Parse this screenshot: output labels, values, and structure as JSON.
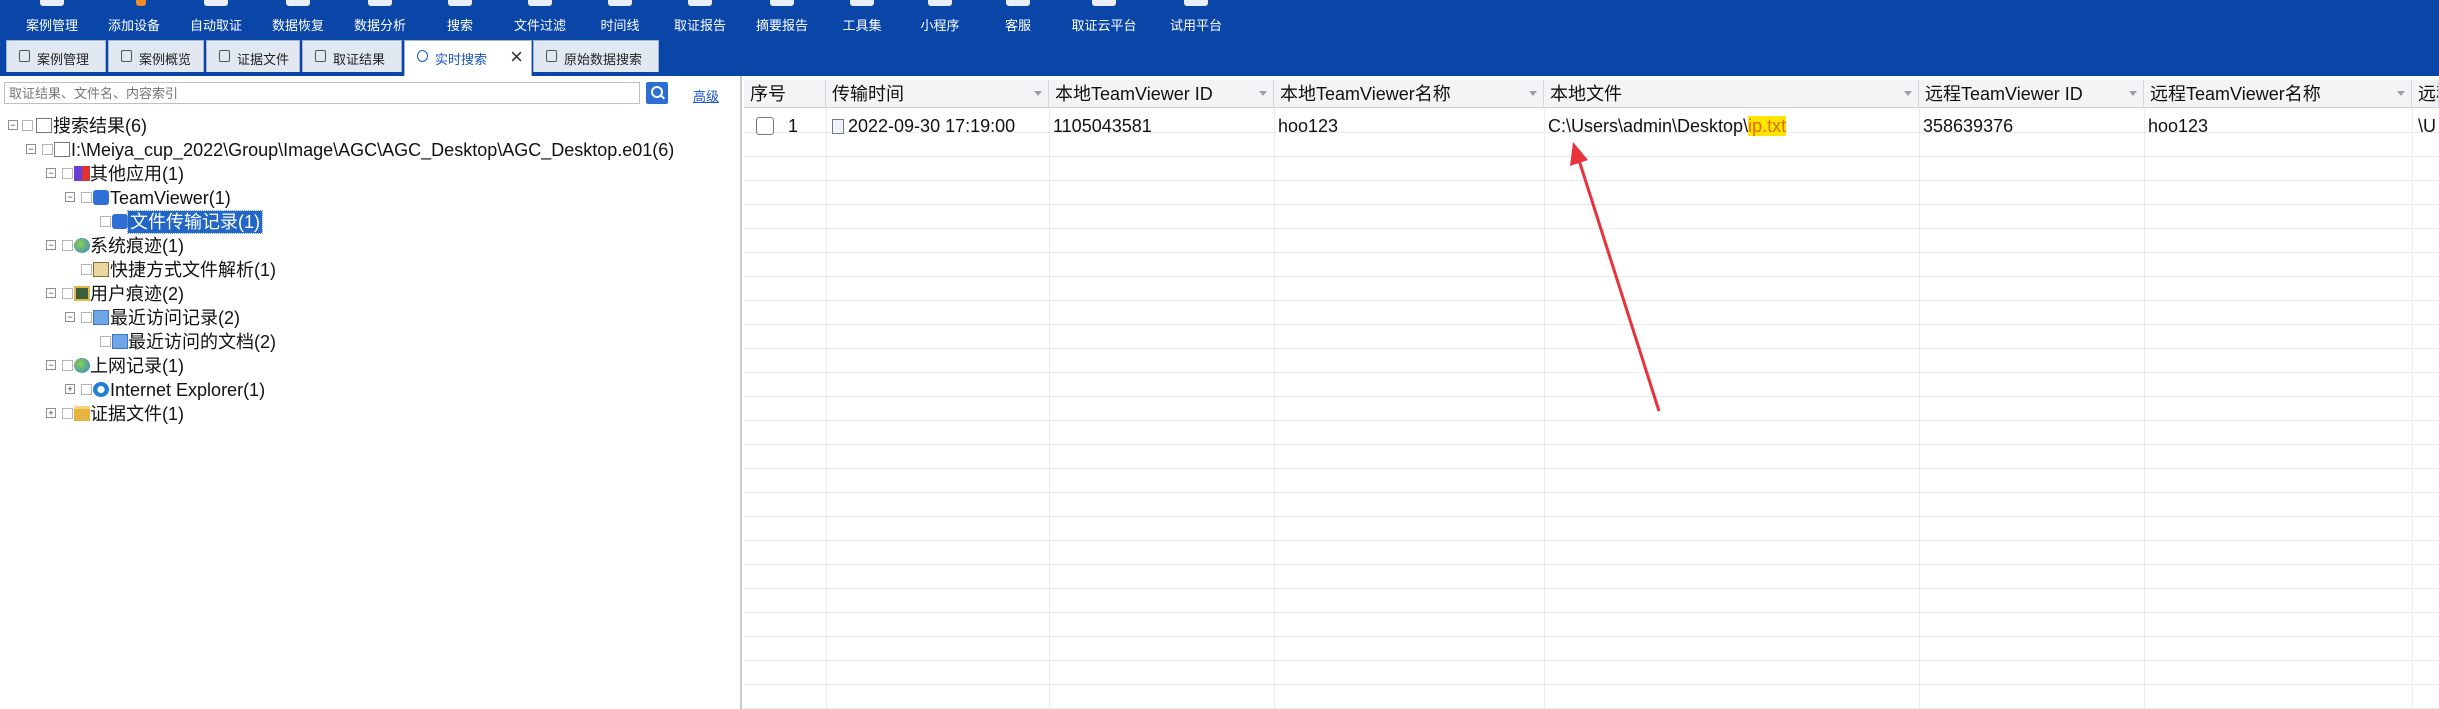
{
  "toolbar": {
    "items": [
      {
        "label": "案例管理",
        "icon": "case-icon"
      },
      {
        "label": "添加设备",
        "icon": "add-device-icon"
      },
      {
        "label": "自动取证",
        "icon": "auto-forensics-icon"
      },
      {
        "label": "数据恢复",
        "icon": "data-recovery-icon"
      },
      {
        "label": "数据分析",
        "icon": "data-analysis-icon"
      },
      {
        "label": "搜索",
        "icon": "search-icon"
      },
      {
        "label": "文件过滤",
        "icon": "file-filter-icon"
      },
      {
        "label": "时间线",
        "icon": "timeline-icon"
      },
      {
        "label": "取证报告",
        "icon": "report-icon"
      },
      {
        "label": "摘要报告",
        "icon": "summary-report-icon"
      },
      {
        "label": "工具集",
        "icon": "toolset-icon"
      },
      {
        "label": "小程序",
        "icon": "mini-program-icon"
      },
      {
        "label": "客服",
        "icon": "support-icon"
      },
      {
        "label": "取证云平台",
        "icon": "cloud-platform-icon"
      },
      {
        "label": "试用平台",
        "icon": "trial-platform-icon"
      }
    ],
    "bg_color": "#0a46a8"
  },
  "tabs": [
    {
      "label": "案例管理",
      "icon": "edit-icon"
    },
    {
      "label": "案例概览",
      "icon": "overview-icon"
    },
    {
      "label": "证据文件",
      "icon": "evidence-file-icon"
    },
    {
      "label": "取证结果",
      "icon": "result-icon"
    },
    {
      "label": "实时搜索",
      "icon": "search-icon",
      "active": true
    },
    {
      "label": "原始数据搜索",
      "icon": "raw-search-icon"
    }
  ],
  "left": {
    "search_placeholder": "取证结果、文件名、内容索引",
    "advanced_label": "高级"
  },
  "tree": [
    {
      "label": "搜索结果(6)",
      "icon": "doc"
    },
    {
      "label": "I:\\Meiya_cup_2022\\Group\\Image\\AGC\\AGC_Desktop\\AGC_Desktop.e01(6)",
      "icon": "doc"
    },
    {
      "label": "其他应用(1)",
      "icon": "apps"
    },
    {
      "label": "TeamViewer(1)",
      "icon": "tv"
    },
    {
      "label": "文件传输记录(1)",
      "icon": "tv",
      "selected": true
    },
    {
      "label": "系统痕迹(1)",
      "icon": "globe"
    },
    {
      "label": "快捷方式文件解析(1)",
      "icon": "lnk"
    },
    {
      "label": "用户痕迹(2)",
      "icon": "user"
    },
    {
      "label": "最近访问记录(2)",
      "icon": "recent"
    },
    {
      "label": "最近访问的文档(2)",
      "icon": "recent"
    },
    {
      "label": "上网记录(1)",
      "icon": "globe"
    },
    {
      "label": "Internet Explorer(1)",
      "icon": "ie"
    },
    {
      "label": "证据文件(1)",
      "icon": "folder"
    }
  ],
  "grid": {
    "columns": [
      "序号",
      "传输时间",
      "本地TeamViewer ID",
      "本地TeamViewer名称",
      "本地文件",
      "远程TeamViewer ID",
      "远程TeamViewer名称",
      "远程"
    ],
    "rows": [
      {
        "index": "1",
        "time": "2022-09-30 17:19:00",
        "local_id": "1105043581",
        "local_name": "hoo123",
        "local_file_prefix": "C:\\Users\\admin\\Desktop\\",
        "local_file_highlight": "ip.txt",
        "remote_id": "358639376",
        "remote_name": "hoo123",
        "remote_more": "\\U"
      }
    ]
  },
  "annotation_color": "#e8323c",
  "highlight_color": "#ffe600"
}
